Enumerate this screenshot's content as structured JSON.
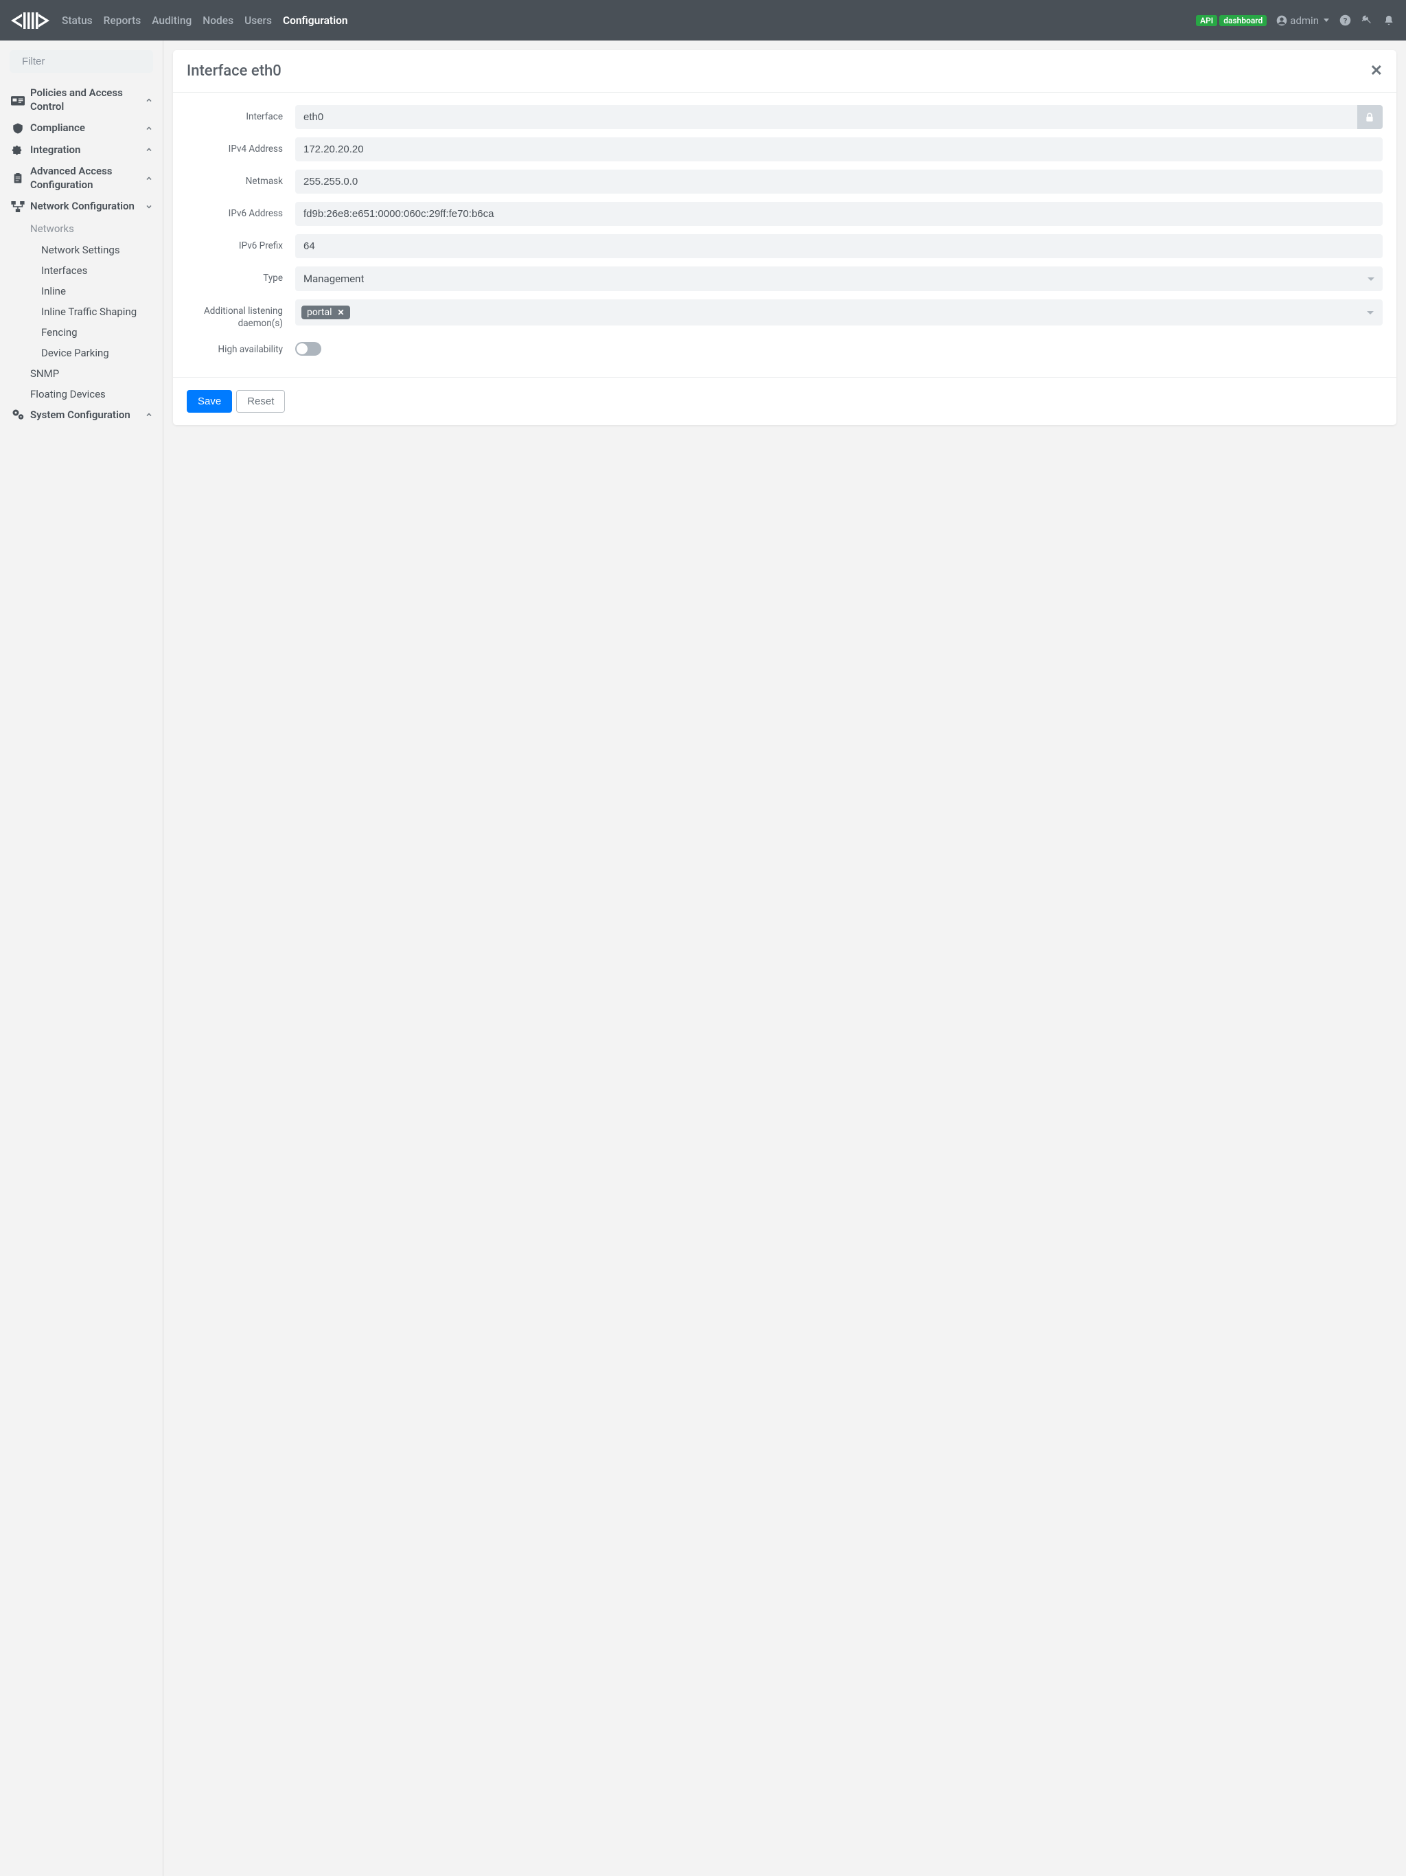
{
  "topnav": {
    "items": [
      "Status",
      "Reports",
      "Auditing",
      "Nodes",
      "Users",
      "Configuration"
    ],
    "activeIndex": 5
  },
  "topbar": {
    "api_badge": "API",
    "dash_badge": "dashboard",
    "user": "admin"
  },
  "sidebar": {
    "filter_placeholder": "Filter",
    "sections": {
      "policies": "Policies and Access Control",
      "compliance": "Compliance",
      "integration": "Integration",
      "advanced": "Advanced Access Configuration",
      "network": "Network Configuration",
      "system": "System Configuration"
    },
    "network_sub": {
      "heading": "Networks",
      "items": [
        "Network Settings",
        "Interfaces",
        "Inline",
        "Inline Traffic Shaping",
        "Fencing",
        "Device Parking"
      ],
      "snmp": "SNMP",
      "floating": "Floating Devices"
    }
  },
  "panel": {
    "title": "Interface eth0",
    "labels": {
      "interface": "Interface",
      "ipv4": "IPv4 Address",
      "netmask": "Netmask",
      "ipv6": "IPv6 Address",
      "ipv6prefix": "IPv6 Prefix",
      "type": "Type",
      "daemons": "Additional listening daemon(s)",
      "ha": "High availability"
    },
    "values": {
      "interface": "eth0",
      "ipv4": "172.20.20.20",
      "netmask": "255.255.0.0",
      "ipv6": "fd9b:26e8:e651:0000:060c:29ff:fe70:b6ca",
      "ipv6prefix": "64",
      "type": "Management",
      "daemon_tag": "portal"
    },
    "buttons": {
      "save": "Save",
      "reset": "Reset"
    }
  }
}
